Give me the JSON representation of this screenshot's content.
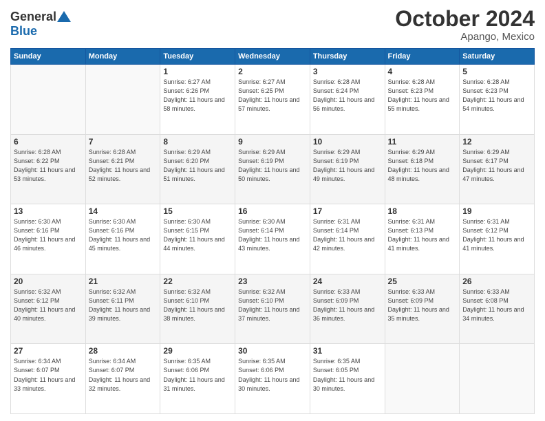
{
  "header": {
    "logo_general": "General",
    "logo_blue": "Blue",
    "month": "October 2024",
    "location": "Apango, Mexico"
  },
  "days_of_week": [
    "Sunday",
    "Monday",
    "Tuesday",
    "Wednesday",
    "Thursday",
    "Friday",
    "Saturday"
  ],
  "weeks": [
    [
      {
        "num": "",
        "info": ""
      },
      {
        "num": "",
        "info": ""
      },
      {
        "num": "1",
        "info": "Sunrise: 6:27 AM\nSunset: 6:26 PM\nDaylight: 11 hours and 58 minutes."
      },
      {
        "num": "2",
        "info": "Sunrise: 6:27 AM\nSunset: 6:25 PM\nDaylight: 11 hours and 57 minutes."
      },
      {
        "num": "3",
        "info": "Sunrise: 6:28 AM\nSunset: 6:24 PM\nDaylight: 11 hours and 56 minutes."
      },
      {
        "num": "4",
        "info": "Sunrise: 6:28 AM\nSunset: 6:23 PM\nDaylight: 11 hours and 55 minutes."
      },
      {
        "num": "5",
        "info": "Sunrise: 6:28 AM\nSunset: 6:23 PM\nDaylight: 11 hours and 54 minutes."
      }
    ],
    [
      {
        "num": "6",
        "info": "Sunrise: 6:28 AM\nSunset: 6:22 PM\nDaylight: 11 hours and 53 minutes."
      },
      {
        "num": "7",
        "info": "Sunrise: 6:28 AM\nSunset: 6:21 PM\nDaylight: 11 hours and 52 minutes."
      },
      {
        "num": "8",
        "info": "Sunrise: 6:29 AM\nSunset: 6:20 PM\nDaylight: 11 hours and 51 minutes."
      },
      {
        "num": "9",
        "info": "Sunrise: 6:29 AM\nSunset: 6:19 PM\nDaylight: 11 hours and 50 minutes."
      },
      {
        "num": "10",
        "info": "Sunrise: 6:29 AM\nSunset: 6:19 PM\nDaylight: 11 hours and 49 minutes."
      },
      {
        "num": "11",
        "info": "Sunrise: 6:29 AM\nSunset: 6:18 PM\nDaylight: 11 hours and 48 minutes."
      },
      {
        "num": "12",
        "info": "Sunrise: 6:29 AM\nSunset: 6:17 PM\nDaylight: 11 hours and 47 minutes."
      }
    ],
    [
      {
        "num": "13",
        "info": "Sunrise: 6:30 AM\nSunset: 6:16 PM\nDaylight: 11 hours and 46 minutes."
      },
      {
        "num": "14",
        "info": "Sunrise: 6:30 AM\nSunset: 6:16 PM\nDaylight: 11 hours and 45 minutes."
      },
      {
        "num": "15",
        "info": "Sunrise: 6:30 AM\nSunset: 6:15 PM\nDaylight: 11 hours and 44 minutes."
      },
      {
        "num": "16",
        "info": "Sunrise: 6:30 AM\nSunset: 6:14 PM\nDaylight: 11 hours and 43 minutes."
      },
      {
        "num": "17",
        "info": "Sunrise: 6:31 AM\nSunset: 6:14 PM\nDaylight: 11 hours and 42 minutes."
      },
      {
        "num": "18",
        "info": "Sunrise: 6:31 AM\nSunset: 6:13 PM\nDaylight: 11 hours and 41 minutes."
      },
      {
        "num": "19",
        "info": "Sunrise: 6:31 AM\nSunset: 6:12 PM\nDaylight: 11 hours and 41 minutes."
      }
    ],
    [
      {
        "num": "20",
        "info": "Sunrise: 6:32 AM\nSunset: 6:12 PM\nDaylight: 11 hours and 40 minutes."
      },
      {
        "num": "21",
        "info": "Sunrise: 6:32 AM\nSunset: 6:11 PM\nDaylight: 11 hours and 39 minutes."
      },
      {
        "num": "22",
        "info": "Sunrise: 6:32 AM\nSunset: 6:10 PM\nDaylight: 11 hours and 38 minutes."
      },
      {
        "num": "23",
        "info": "Sunrise: 6:32 AM\nSunset: 6:10 PM\nDaylight: 11 hours and 37 minutes."
      },
      {
        "num": "24",
        "info": "Sunrise: 6:33 AM\nSunset: 6:09 PM\nDaylight: 11 hours and 36 minutes."
      },
      {
        "num": "25",
        "info": "Sunrise: 6:33 AM\nSunset: 6:09 PM\nDaylight: 11 hours and 35 minutes."
      },
      {
        "num": "26",
        "info": "Sunrise: 6:33 AM\nSunset: 6:08 PM\nDaylight: 11 hours and 34 minutes."
      }
    ],
    [
      {
        "num": "27",
        "info": "Sunrise: 6:34 AM\nSunset: 6:07 PM\nDaylight: 11 hours and 33 minutes."
      },
      {
        "num": "28",
        "info": "Sunrise: 6:34 AM\nSunset: 6:07 PM\nDaylight: 11 hours and 32 minutes."
      },
      {
        "num": "29",
        "info": "Sunrise: 6:35 AM\nSunset: 6:06 PM\nDaylight: 11 hours and 31 minutes."
      },
      {
        "num": "30",
        "info": "Sunrise: 6:35 AM\nSunset: 6:06 PM\nDaylight: 11 hours and 30 minutes."
      },
      {
        "num": "31",
        "info": "Sunrise: 6:35 AM\nSunset: 6:05 PM\nDaylight: 11 hours and 30 minutes."
      },
      {
        "num": "",
        "info": ""
      },
      {
        "num": "",
        "info": ""
      }
    ]
  ]
}
